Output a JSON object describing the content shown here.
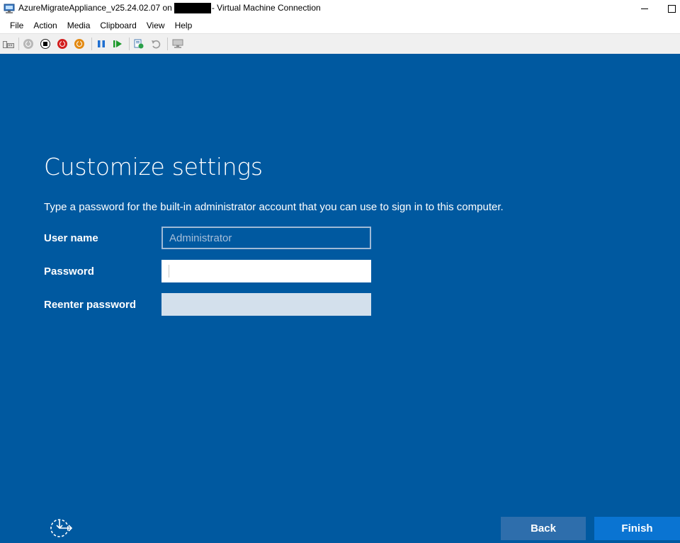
{
  "window": {
    "title_prefix": "AzureMigrateAppliance_v25.24.02.07 on",
    "title_suffix": "- Virtual Machine Connection"
  },
  "menu": [
    "File",
    "Action",
    "Media",
    "Clipboard",
    "View",
    "Help"
  ],
  "toolbar": {
    "icons": [
      "ctrl-alt-del-icon",
      "start-icon",
      "turn-off-icon",
      "shut-down-icon",
      "save-state-icon",
      "pause-icon",
      "resume-icon",
      "checkpoint-icon",
      "revert-icon",
      "enhanced-session-icon"
    ]
  },
  "setup": {
    "title": "Customize settings",
    "description": "Type a password for the built-in administrator account that you can use to sign in to this computer.",
    "user_name_label": "User name",
    "user_name_placeholder": "Administrator",
    "password_label": "Password",
    "reenter_password_label": "Reenter password",
    "back_label": "Back",
    "finish_label": "Finish"
  },
  "colors": {
    "screen_bg": "#0059a0",
    "finish_button": "#0a74d2",
    "back_button": "#2e6eac"
  }
}
